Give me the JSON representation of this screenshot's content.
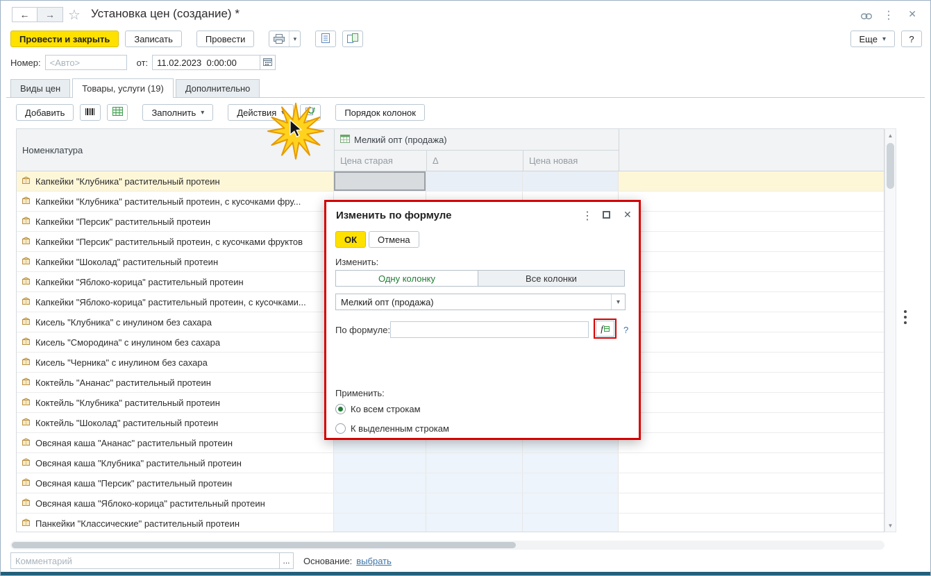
{
  "titlebar": {
    "title": "Установка цен (создание) *"
  },
  "toolbar": {
    "post_and_close": "Провести и закрыть",
    "write": "Записать",
    "post": "Провести",
    "more": "Еще",
    "help": "?"
  },
  "form": {
    "number_label": "Номер:",
    "number_placeholder": "<Авто>",
    "date_label": "от:",
    "date_value": "11.02.2023  0:00:00"
  },
  "tabs": [
    {
      "label": "Виды цен"
    },
    {
      "label": "Товары, услуги (19)"
    },
    {
      "label": "Дополнительно"
    }
  ],
  "table_toolbar": {
    "add": "Добавить",
    "fill": "Заполнить",
    "actions": "Действия",
    "column_order": "Порядок колонок"
  },
  "table": {
    "headers": {
      "nomenclature": "Номенклатура",
      "price_group": "Мелкий опт (продажа)",
      "old_price": "Цена старая",
      "delta": "Δ",
      "new_price": "Цена новая"
    },
    "rows": [
      {
        "name": "Капкейки \"Клубника\" растительный протеин",
        "selected": true
      },
      {
        "name": "Капкейки \"Клубника\" растительный протеин,  с кусочками фру...",
        "selected": false
      },
      {
        "name": "Капкейки \"Персик\" растительный протеин",
        "selected": false
      },
      {
        "name": "Капкейки \"Персик\" растительный протеин, с кусочками фруктов",
        "selected": false
      },
      {
        "name": "Капкейки \"Шоколад\" растительный протеин",
        "selected": false
      },
      {
        "name": "Капкейки \"Яблоко-корица\" растительный протеин",
        "selected": false
      },
      {
        "name": "Капкейки \"Яблоко-корица\" растительный протеин, с кусочками...",
        "selected": false
      },
      {
        "name": "Кисель \"Клубника\" с инулином без сахара",
        "selected": false
      },
      {
        "name": "Кисель \"Смородина\" с инулином без сахара",
        "selected": false
      },
      {
        "name": "Кисель \"Черника\" с инулином без сахара",
        "selected": false
      },
      {
        "name": "Коктейль \"Ананас\" растительный протеин",
        "selected": false
      },
      {
        "name": "Коктейль \"Клубника\" растительный протеин",
        "selected": false
      },
      {
        "name": "Коктейль \"Шоколад\" растительный протеин",
        "selected": false
      },
      {
        "name": "Овсяная каша \"Ананас\" растительный протеин",
        "selected": false
      },
      {
        "name": "Овсяная каша \"Клубника\" растительный протеин",
        "selected": false
      },
      {
        "name": "Овсяная каша \"Персик\" растительный протеин",
        "selected": false
      },
      {
        "name": "Овсяная каша \"Яблоко-корица\" растительный протеин",
        "selected": false
      },
      {
        "name": "Панкейки \"Классические\" растительный протеин",
        "selected": false
      }
    ]
  },
  "dialog": {
    "title": "Изменить по формуле",
    "ok_label": "ОК",
    "cancel_label": "Отмена",
    "change_label": "Изменить:",
    "one_column": "Одну колонку",
    "all_columns": "Все колонки",
    "column_value": "Мелкий опт (продажа)",
    "formula_label": "По формуле:",
    "formula_value": "",
    "help_label": "?",
    "apply_label": "Применить:",
    "apply_all": "Ко всем строкам",
    "apply_selected": "К выделенным строкам"
  },
  "footer": {
    "comment_placeholder": "Комментарий",
    "ellipsis_button": "...",
    "basis_label": "Основание:",
    "basis_link": "выбрать"
  },
  "colors": {
    "accent_yellow": "#ffe100",
    "annotation_red": "#d40000",
    "accent_green": "#1e7e34",
    "link_blue": "#3b74a8",
    "selected_row": "#fdf7d8"
  }
}
